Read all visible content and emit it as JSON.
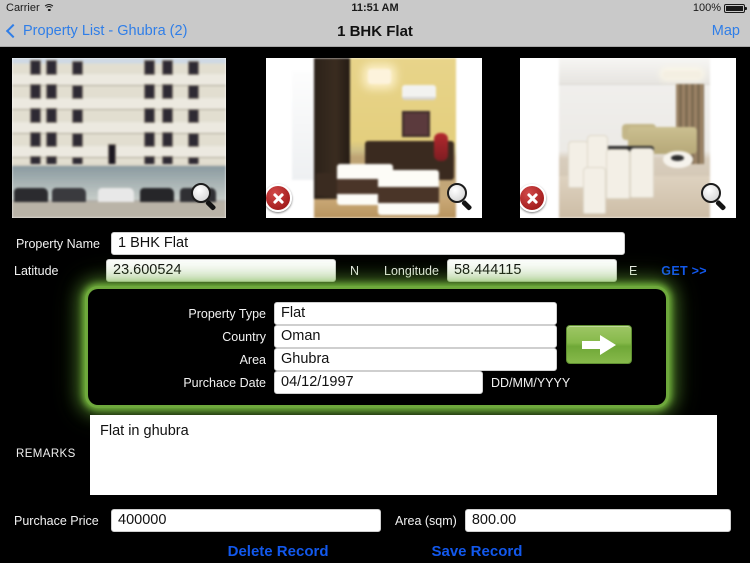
{
  "status_bar": {
    "carrier": "Carrier",
    "wifi_icon": "wifi-icon",
    "time": "11:51 AM",
    "battery_percent": "100%",
    "battery_icon": "battery-full-icon"
  },
  "nav_bar": {
    "back_icon": "chevron-left-icon",
    "back_label": "Property List - Ghubra (2)",
    "title": "1 BHK Flat",
    "right_label": "Map"
  },
  "photos": [
    {
      "name": "property-photo-1",
      "alt": "building-exterior",
      "delete_badge": false,
      "zoom_icon": "magnifier-icon"
    },
    {
      "name": "property-photo-2",
      "alt": "bedroom-interior",
      "delete_badge": true,
      "zoom_icon": "magnifier-icon"
    },
    {
      "name": "property-photo-3",
      "alt": "living-dining-interior",
      "delete_badge": true,
      "zoom_icon": "magnifier-icon"
    }
  ],
  "form": {
    "property_name_label": "Property Name",
    "property_name_value": "1 BHK Flat",
    "latitude_label": "Latitude",
    "latitude_value": "23.600524",
    "latitude_unit": "N",
    "longitude_label": "Longitude",
    "longitude_value": "58.444115",
    "longitude_unit": "E",
    "get_label": "GET >>"
  },
  "highlighted_panel": {
    "property_type_label": "Property Type",
    "property_type_value": "Flat",
    "country_label": "Country",
    "country_value": "Oman",
    "area_label": "Area",
    "area_value": "Ghubra",
    "purchase_date_label": "Purchace Date",
    "purchase_date_value": "04/12/1997",
    "purchase_date_format": "DD/MM/YYYY",
    "next_arrow_icon": "arrow-right-icon"
  },
  "remarks": {
    "label": "REMARKS",
    "value": "Flat in ghubra"
  },
  "bottom_form": {
    "purchase_price_label": "Purchace Price",
    "purchase_price_value": "400000",
    "area_sqm_label": "Area (sqm)",
    "area_sqm_value": "800.00"
  },
  "footer": {
    "delete_label": "Delete Record",
    "save_label": "Save Record"
  },
  "colors": {
    "background": "#000000",
    "nav_bar": "#c9c9c9",
    "link_blue": "#2f7ee8",
    "action_blue": "#1258ec",
    "highlight_green": "#6ea83c",
    "delete_badge_red": "#a61f1f"
  }
}
